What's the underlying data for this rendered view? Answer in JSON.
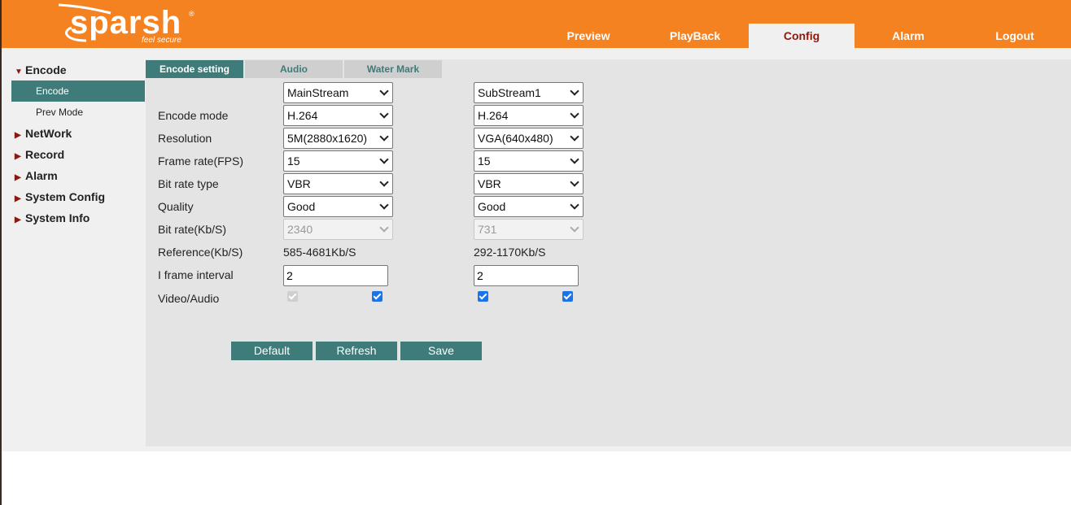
{
  "logo": {
    "name": "sparsh",
    "tagline": "feel secure",
    "reg": "®"
  },
  "nav": [
    "Preview",
    "PlayBack",
    "Config",
    "Alarm",
    "Logout"
  ],
  "sidebar": {
    "encode_group": "Encode",
    "encode_items": [
      "Encode",
      "Prev Mode"
    ],
    "groups": [
      "NetWork",
      "Record",
      "Alarm",
      "System Config",
      "System Info"
    ]
  },
  "tabs": [
    "Encode setting",
    "Audio",
    "Water Mark"
  ],
  "form": {
    "labels": {
      "encode_mode": "Encode mode",
      "resolution": "Resolution",
      "frame_rate": "Frame rate(FPS)",
      "bit_rate_type": "Bit rate type",
      "quality": "Quality",
      "bit_rate": "Bit rate(Kb/S)",
      "reference": "Reference(Kb/S)",
      "iframe": "I frame interval",
      "video_audio": "Video/Audio"
    },
    "main": {
      "stream": "MainStream",
      "encode_mode": "H.264",
      "resolution": "5M(2880x1620)",
      "frame_rate": "15",
      "bit_rate_type": "VBR",
      "quality": "Good",
      "bit_rate": "2340",
      "reference": "585-4681Kb/S",
      "iframe": "2"
    },
    "sub": {
      "stream": "SubStream1",
      "encode_mode": "H.264",
      "resolution": "VGA(640x480)",
      "frame_rate": "15",
      "bit_rate_type": "VBR",
      "quality": "Good",
      "bit_rate": "731",
      "reference": "292-1170Kb/S",
      "iframe": "2"
    }
  },
  "buttons": {
    "default": "Default",
    "refresh": "Refresh",
    "save": "Save"
  },
  "colors": {
    "brand": "#f58220",
    "accent": "#3f7b78",
    "active_nav_text": "#8a1a10"
  }
}
